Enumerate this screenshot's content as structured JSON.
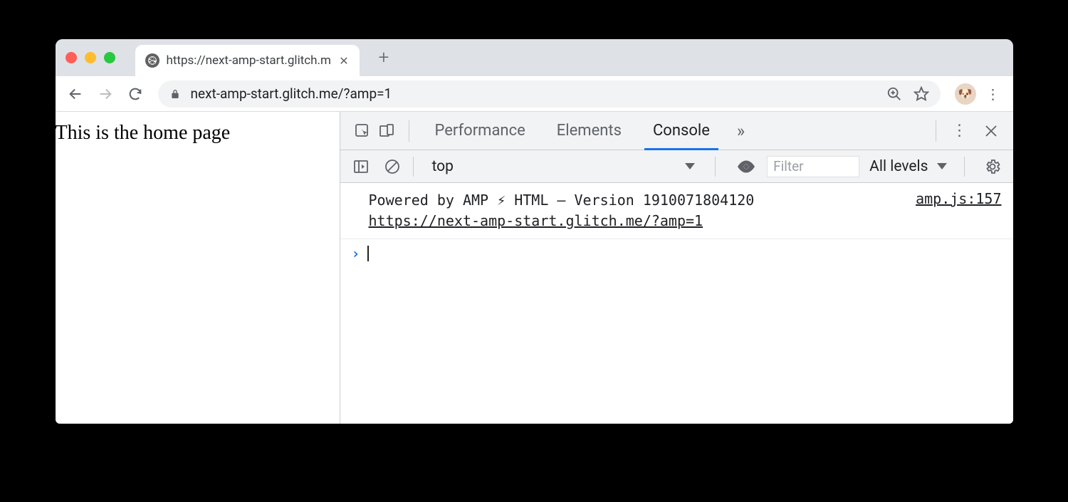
{
  "browser": {
    "tab_title": "https://next-amp-start.glitch.m",
    "url": "next-amp-start.glitch.me/?amp=1"
  },
  "page": {
    "heading": "This is the home page"
  },
  "devtools": {
    "tabs": {
      "performance": "Performance",
      "elements": "Elements",
      "console": "Console"
    },
    "console_toolbar": {
      "context": "top",
      "filter_placeholder": "Filter",
      "levels": "All levels"
    },
    "console_log": {
      "message": "Powered by AMP ⚡ HTML – Version 1910071804120",
      "link": "https://next-amp-start.glitch.me/?amp=1",
      "source": "amp.js:157"
    }
  }
}
